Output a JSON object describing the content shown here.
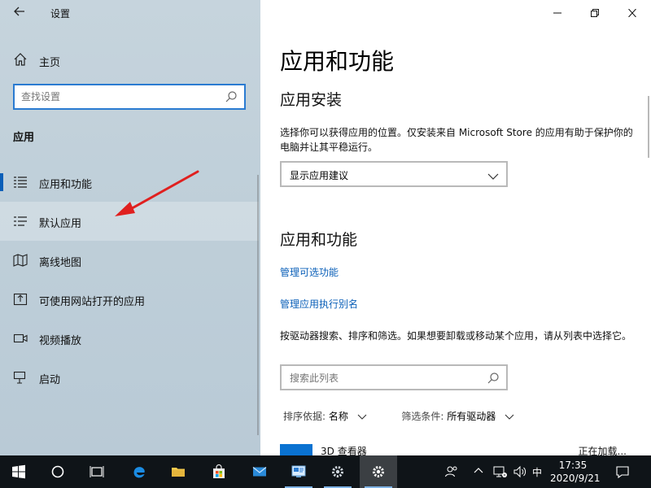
{
  "window": {
    "title": "设置",
    "minimize": "—",
    "restore": "❐",
    "close": "✕"
  },
  "sidebar": {
    "home_label": "主页",
    "search_placeholder": "查找设置",
    "section_label": "应用",
    "items": [
      {
        "label": "应用和功能",
        "icon": "apps-list-icon",
        "selected": true
      },
      {
        "label": "默认应用",
        "icon": "default-apps-icon",
        "hover": true
      },
      {
        "label": "离线地图",
        "icon": "map-icon"
      },
      {
        "label": "可使用网站打开的应用",
        "icon": "open-website-icon"
      },
      {
        "label": "视频播放",
        "icon": "video-icon"
      },
      {
        "label": "启动",
        "icon": "startup-icon"
      }
    ]
  },
  "main": {
    "page_title": "应用和功能",
    "install_heading": "应用安装",
    "install_desc": "选择你可以获得应用的位置。仅安装来自 Microsoft Store 的应用有助于保护你的电脑并让其平稳运行。",
    "install_dropdown_value": "显示应用建议",
    "apps_heading": "应用和功能",
    "link_optional": "管理可选功能",
    "link_alias": "管理应用执行别名",
    "apps_desc": "按驱动器搜索、排序和筛选。如果想要卸载或移动某个应用，请从列表中选择它。",
    "search_list_placeholder": "搜索此列表",
    "sort_label": "排序依据:",
    "sort_value": "名称",
    "filter_label": "筛选条件:",
    "filter_value": "所有驱动器",
    "first_app_name": "3D 查看器",
    "first_app_status": "正在加载..."
  },
  "taskbar": {
    "time": "17:35",
    "date": "2020/9/21",
    "ime": "中",
    "icons": [
      "windows-start-icon",
      "cortana-search-icon",
      "task-view-icon",
      "edge-icon",
      "file-explorer-icon",
      "store-icon",
      "mail-icon",
      "app-icon",
      "settings-gear-icon",
      "settings-active-icon"
    ]
  },
  "colors": {
    "accent": "#0a5fb8",
    "link": "#0a5fb8",
    "annotation_arrow": "#e0201f",
    "taskbar_bg": "#0f1418"
  }
}
